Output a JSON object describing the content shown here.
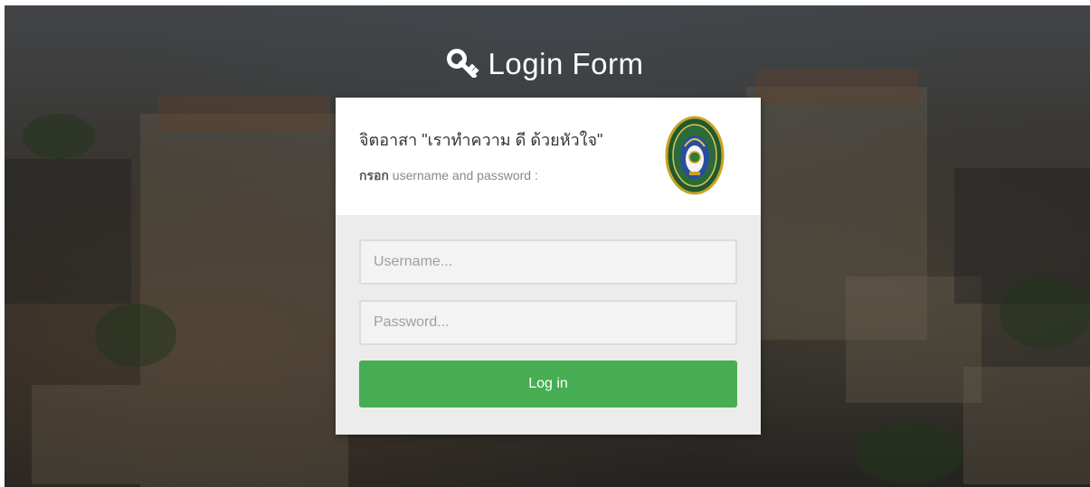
{
  "page": {
    "heading": "Login Form",
    "heading_icon": "key-icon"
  },
  "card": {
    "title": "จิตอาสา \"เราทำความ ดี ด้วยหัวใจ\"",
    "subtitle_strong": "กรอก",
    "subtitle_rest": " username and password :",
    "logo": "university-seal"
  },
  "form": {
    "username_placeholder": "Username...",
    "username_value": "",
    "password_placeholder": "Password...",
    "password_value": "",
    "login_label": "Log in"
  },
  "colors": {
    "login_button": "#46ad52",
    "card_top": "#ffffff",
    "card_bottom": "#ececec",
    "heading_text": "#ffffff"
  }
}
